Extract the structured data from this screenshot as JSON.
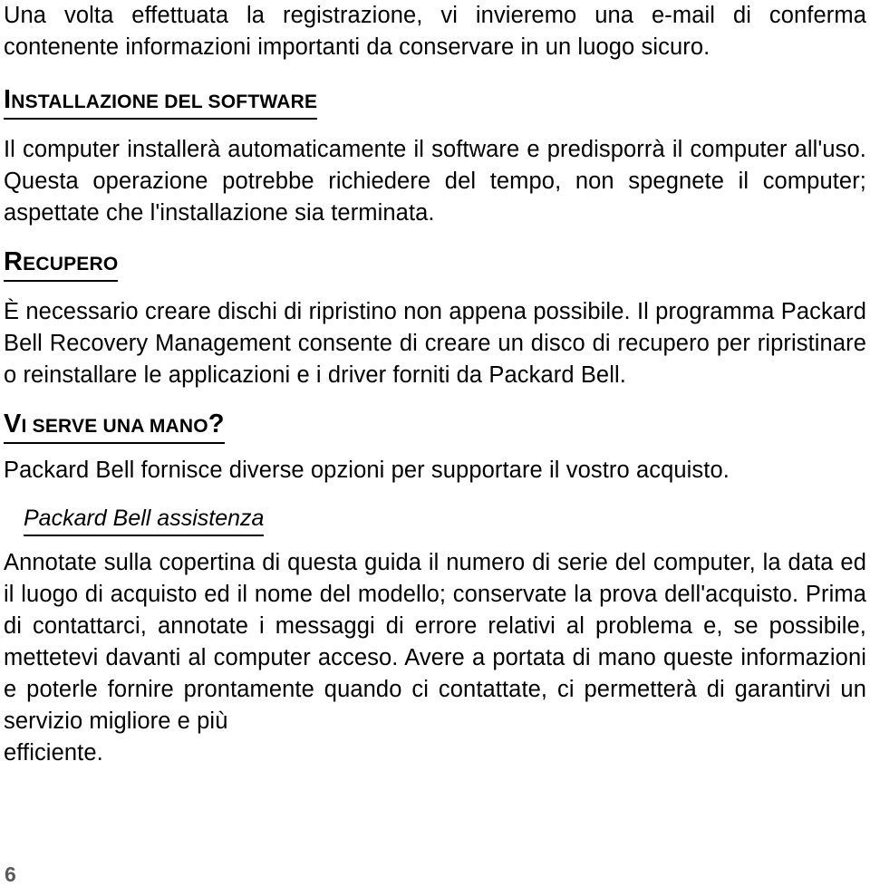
{
  "document": {
    "language": "Italian",
    "page_number": "6",
    "blocks": [
      {
        "type": "paragraph",
        "id": "intro-paragraph",
        "text": "Una volta effettuata la registrazione, vi invieremo una e-mail di conferma contenente informazioni importanti da conservare in un luogo sicuro."
      },
      {
        "type": "heading",
        "id": "heading-installazione",
        "initial": "I",
        "rest": "NSTALLAZIONE DEL SOFTWARE",
        "full_text": "INSTALLAZIONE DEL SOFTWARE"
      },
      {
        "type": "paragraph",
        "id": "installazione-paragraph",
        "text": "Il computer installerà automaticamente il software e predisporrà il computer all'uso. Questa operazione potrebbe richiedere del tempo, non spegnete il computer; aspettate che l'installazione sia terminata."
      },
      {
        "type": "heading",
        "id": "heading-recupero",
        "initial": "R",
        "rest": "ECUPERO",
        "full_text": "RECUPERO"
      },
      {
        "type": "paragraph",
        "id": "recupero-paragraph",
        "text": "È necessario creare dischi di ripristino non appena possibile. Il programma Packard Bell Recovery Management consente di creare un disco di recupero per ripristinare o reinstallare le applicazioni e i driver forniti da Packard Bell."
      },
      {
        "type": "heading",
        "id": "heading-vi-serve-una-mano",
        "initial": "V",
        "rest": "I SERVE UNA MANO",
        "suffix": "?",
        "full_text": "VI SERVE UNA MANO?"
      },
      {
        "type": "paragraph",
        "id": "supporto-paragraph",
        "text": "Packard Bell fornisce diverse opzioni per supportare il vostro acquisto."
      },
      {
        "type": "subheading",
        "id": "subheading-packard-bell-assistenza",
        "text": "Packard Bell assistenza"
      },
      {
        "type": "paragraph",
        "id": "assistenza-paragraph",
        "text": "Annotate sulla copertina di questa guida il numero di serie del computer, la data ed il luogo di acquisto ed il nome del modello; conservate la prova dell'acquisto. Prima di contattarci, annotate i messaggi di errore relativi al problema e, se possibile, mettetevi davanti al computer acceso. Avere a portata di mano queste informazioni e poterle fornire prontamente quando ci contattate, ci permetterà di garantirvi un servizio migliore e più",
        "last_line": "efficiente."
      }
    ]
  },
  "colors": {
    "text": "#000000",
    "page_number": "#5a5a5a",
    "background": "#ffffff"
  }
}
